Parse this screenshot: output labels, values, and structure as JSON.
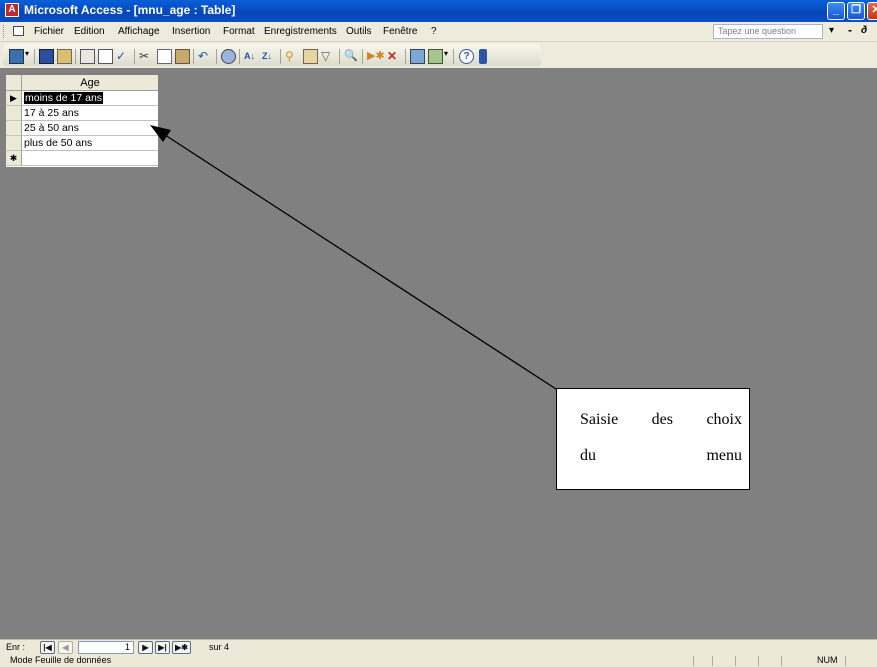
{
  "window": {
    "title": "Microsoft Access - [mnu_age : Table]",
    "app_icon": "access-key-icon",
    "controls": [
      "minimize",
      "restore",
      "close"
    ]
  },
  "menu": {
    "items": [
      "Fichier",
      "Edition",
      "Affichage",
      "Insertion",
      "Format",
      "Enregistrements",
      "Outils",
      "Fenêtre",
      "?"
    ],
    "ask_placeholder": "Tapez une question"
  },
  "toolbar": {
    "icons": [
      "view-icon",
      "save-icon",
      "search-icon",
      "print-icon",
      "print-preview-icon",
      "spelling-icon",
      "cut-icon",
      "copy-icon",
      "paste-icon",
      "undo-icon",
      "hyperlink-icon",
      "sort-asc-icon",
      "sort-desc-icon",
      "filter-selection-icon",
      "filter-form-icon",
      "apply-filter-icon",
      "find-icon",
      "new-record-icon",
      "delete-record-icon",
      "database-window-icon",
      "new-object-icon",
      "help-icon"
    ]
  },
  "datasheet": {
    "column_header": "Age",
    "rows": [
      {
        "selector": "▶",
        "value": "moins de 17 ans"
      },
      {
        "selector": "",
        "value": "17 à 25 ans"
      },
      {
        "selector": "",
        "value": "25 à 50 ans"
      },
      {
        "selector": "",
        "value": "plus de 50 ans"
      },
      {
        "selector": "✱",
        "value": ""
      }
    ]
  },
  "navigation": {
    "label": "Enr :",
    "current": "1",
    "of_label": "sur 4",
    "buttons": [
      "|◀",
      "◀",
      "▶",
      "▶|",
      "▶✱"
    ]
  },
  "status": {
    "text": "Mode Feuille de données",
    "num": "NUM"
  },
  "callout": {
    "line1": "Saisie des choix",
    "line2": "du menu"
  }
}
